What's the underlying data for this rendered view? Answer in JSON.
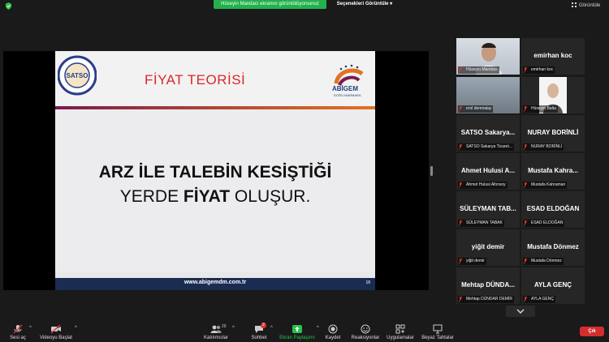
{
  "top": {
    "share_banner": "Hüseyin Mandacı ekranını görüntülüyorsunuz",
    "view_options": "Seçenekleri Görüntüle",
    "view_button": "Görüntüle"
  },
  "slide": {
    "title": "FİYAT TEORİSİ",
    "line1": "ARZ İLE TALEBİN KESİŞTİĞİ",
    "line2_a": "YERDE ",
    "line2_b": "FİYAT",
    "line2_c": " OLUŞUR.",
    "url": "www.abigemdm.com.tr",
    "page": "18",
    "logo_text": "ABİGEM",
    "logo_sub": "DOĞU MARMARA"
  },
  "participants": [
    {
      "name": "Hüseyin Mandacı",
      "big": "",
      "video": true
    },
    {
      "name": "emirhan koc",
      "big": "emirhan koc",
      "video": false
    },
    {
      "name": "erol demiralay",
      "big": "",
      "video": true
    },
    {
      "name": "Hüseyin Balta",
      "big": "",
      "video": true
    },
    {
      "name": "SATSO Sakarya Ticaret...",
      "big": "SATSO  Sakarya...",
      "video": false
    },
    {
      "name": "NURAY BORİNLİ",
      "big": "NURAY BORİNLİ",
      "video": false
    },
    {
      "name": "Ahmet Hulusi Altınsoy",
      "big": "Ahmet Hulusi A...",
      "video": false
    },
    {
      "name": "Mustafa Kahraman",
      "big": "Mustafa  Kahra...",
      "video": false
    },
    {
      "name": "SÜLEYMAN TABAK",
      "big": "SÜLEYMAN  TAB...",
      "video": false
    },
    {
      "name": "ESAD ELDOĞAN",
      "big": "ESAD ELDOĞAN",
      "video": false
    },
    {
      "name": "yiğit demir",
      "big": "yiğit demir",
      "video": false
    },
    {
      "name": "Mustafa Dönmez",
      "big": "Mustafa Dönmez",
      "video": false
    },
    {
      "name": "Mehtap DÜNDAR DEMİR",
      "big": "Mehtap  DÜNDA...",
      "video": false
    },
    {
      "name": "AYLA GENÇ",
      "big": "AYLA GENÇ",
      "video": false
    }
  ],
  "toolbar": {
    "audio": "Sesi aç",
    "video": "Videoyu Başlat",
    "participants": "Katılımcılar",
    "participants_count": "29",
    "chat": "Sohbet",
    "chat_badge": "2",
    "share": "Ekran Paylaşımı",
    "record": "Kaydet",
    "reactions": "Reaksiyonlar",
    "apps": "Uygulamalar",
    "whiteboard": "Beyaz Tahtalar",
    "leave": "Çık"
  },
  "colors": {
    "banner": "#23b14d",
    "leave": "#d32d2d",
    "active_speaker": "#b8d84a",
    "slide_title": "#d9272a",
    "slide_footer": "#1a2c52"
  }
}
